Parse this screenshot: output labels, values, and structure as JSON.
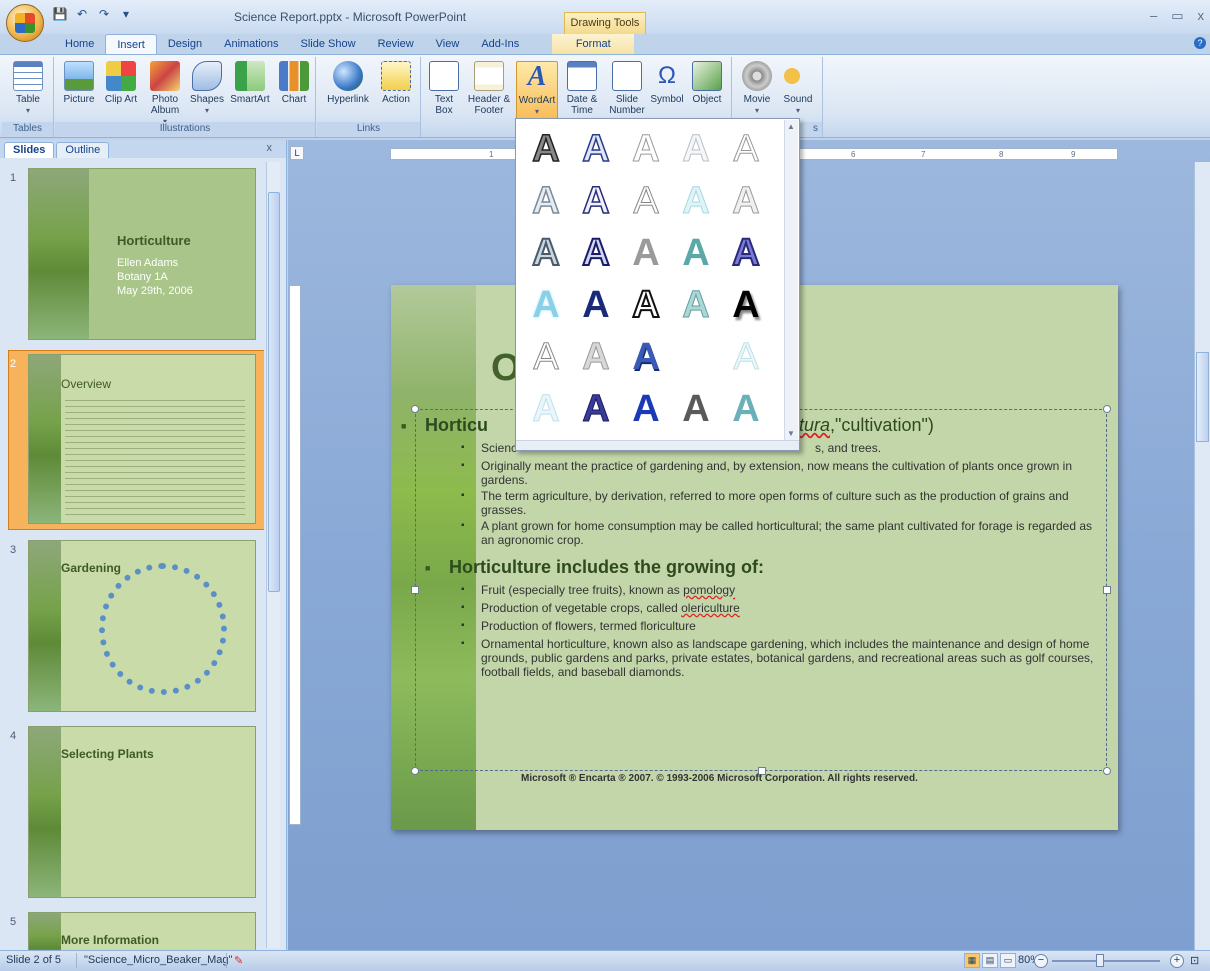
{
  "window": {
    "title": "Science Report.pptx - Microsoft PowerPoint",
    "context_tab_group": "Drawing Tools",
    "controls": [
      "–",
      "▭",
      "x"
    ]
  },
  "quick_access": {
    "icons": [
      "save-icon",
      "undo-icon",
      "redo-icon",
      "customize-icon"
    ]
  },
  "tabs": [
    {
      "label": "Home"
    },
    {
      "label": "Insert"
    },
    {
      "label": "Design"
    },
    {
      "label": "Animations"
    },
    {
      "label": "Slide Show"
    },
    {
      "label": "Review"
    },
    {
      "label": "View"
    },
    {
      "label": "Add-Ins"
    },
    {
      "label": "Format"
    }
  ],
  "ribbon": {
    "groups": {
      "tables": "Tables",
      "illustrations": "Illustrations",
      "links": "Links",
      "media": "s"
    },
    "buttons": {
      "table": "Table",
      "picture": "Picture",
      "clip_art": "Clip Art",
      "photo_album": "Photo Album",
      "shapes": "Shapes",
      "smartart": "SmartArt",
      "chart": "Chart",
      "hyperlink": "Hyperlink",
      "action": "Action",
      "text_box": "Text Box",
      "header_footer": "Header & Footer",
      "wordart": "WordArt",
      "date_time": "Date & Time",
      "slide_number": "Slide Number",
      "symbol": "Symbol",
      "object": "Object",
      "movie": "Movie",
      "sound": "Sound"
    }
  },
  "pane": {
    "tabs": [
      "Slides",
      "Outline"
    ],
    "close": "x"
  },
  "thumbnails": [
    {
      "num": "1",
      "title": "Horticulture",
      "lines": [
        "Ellen Adams",
        "Botany 1A",
        "May 29th, 2006"
      ]
    },
    {
      "num": "2",
      "title": "Overview",
      "selected": true
    },
    {
      "num": "3",
      "title": "Gardening"
    },
    {
      "num": "4",
      "title": "Selecting Plants"
    },
    {
      "num": "5",
      "title": "More Information"
    }
  ],
  "ruler": {
    "marks": [
      "1",
      "6",
      "7",
      "8",
      "9"
    ]
  },
  "slide": {
    "title_visible": "O",
    "heading1_left": "Horticu",
    "heading1_right_italic": "tura",
    "heading1_right_rest": ",\"cultivation\")",
    "bullet1_partial_left": "Scienc",
    "bullet1_partial_right": "s, and trees.",
    "bullets_a": [
      "Originally meant the practice of gardening and, by extension, now means the cultivation of plants once grown in gardens.",
      "The term agriculture, by derivation, referred to more open forms of culture such as the production of grains and grasses.",
      "A plant grown for home consumption may be called horticultural; the same plant cultivated for forage is regarded as an agronomic crop."
    ],
    "heading2": "Horticulture includes the growing of:",
    "bullets_b": [
      {
        "pre": "Fruit (especially tree fruits), known as ",
        "err": "pomology",
        "post": ""
      },
      {
        "pre": "Production of vegetable crops, called ",
        "err": "olericulture",
        "post": ""
      },
      {
        "pre": "Production of flowers, termed floriculture",
        "err": "",
        "post": ""
      },
      {
        "pre": "Ornamental horticulture, known also as landscape gardening, which includes the maintenance and design of home grounds, public gardens and parks, private estates, botanical gardens, and recreational areas such as golf courses, football fields, and baseball diamonds.",
        "err": "",
        "post": ""
      }
    ],
    "credit": "Microsoft ® Encarta ® 2007. © 1993-2006 Microsoft Corporation. All rights reserved."
  },
  "wordart_gallery": {
    "letter": "A",
    "styles": [
      [
        "plain-gray-outline",
        "blue-outline",
        "light-outline",
        "pale-outline",
        "thin-italic"
      ],
      [
        "gray-outline",
        "navy-outline",
        "thin-outline",
        "cyan-soft",
        "gray-soft"
      ],
      [
        "steel-bevel",
        "navy-bevel",
        "gray-gradient",
        "teal-gradient",
        "purple-bevel"
      ],
      [
        "cyan-glow",
        "navy-solid",
        "black-white",
        "teal-reflect",
        "black-shadow"
      ],
      [
        "gray-reflect",
        "silver",
        "blue-3d",
        "empty",
        "pale-cyan"
      ],
      [
        "ice",
        "indigo-gradient",
        "royal-blue",
        "gray-bold",
        "teal-bold"
      ]
    ]
  },
  "status": {
    "slide_of": "Slide 2 of 5",
    "theme": "\"Science_Micro_Beaker_Mag\"",
    "zoom": "80%",
    "zoom_level_percent": 80
  },
  "colors": {
    "ribbon_blue": "#dbe6f4",
    "slide_green": "#c2d6a9",
    "selected_orange": "#f7b35b",
    "context_yellow": "#f3d98a"
  }
}
